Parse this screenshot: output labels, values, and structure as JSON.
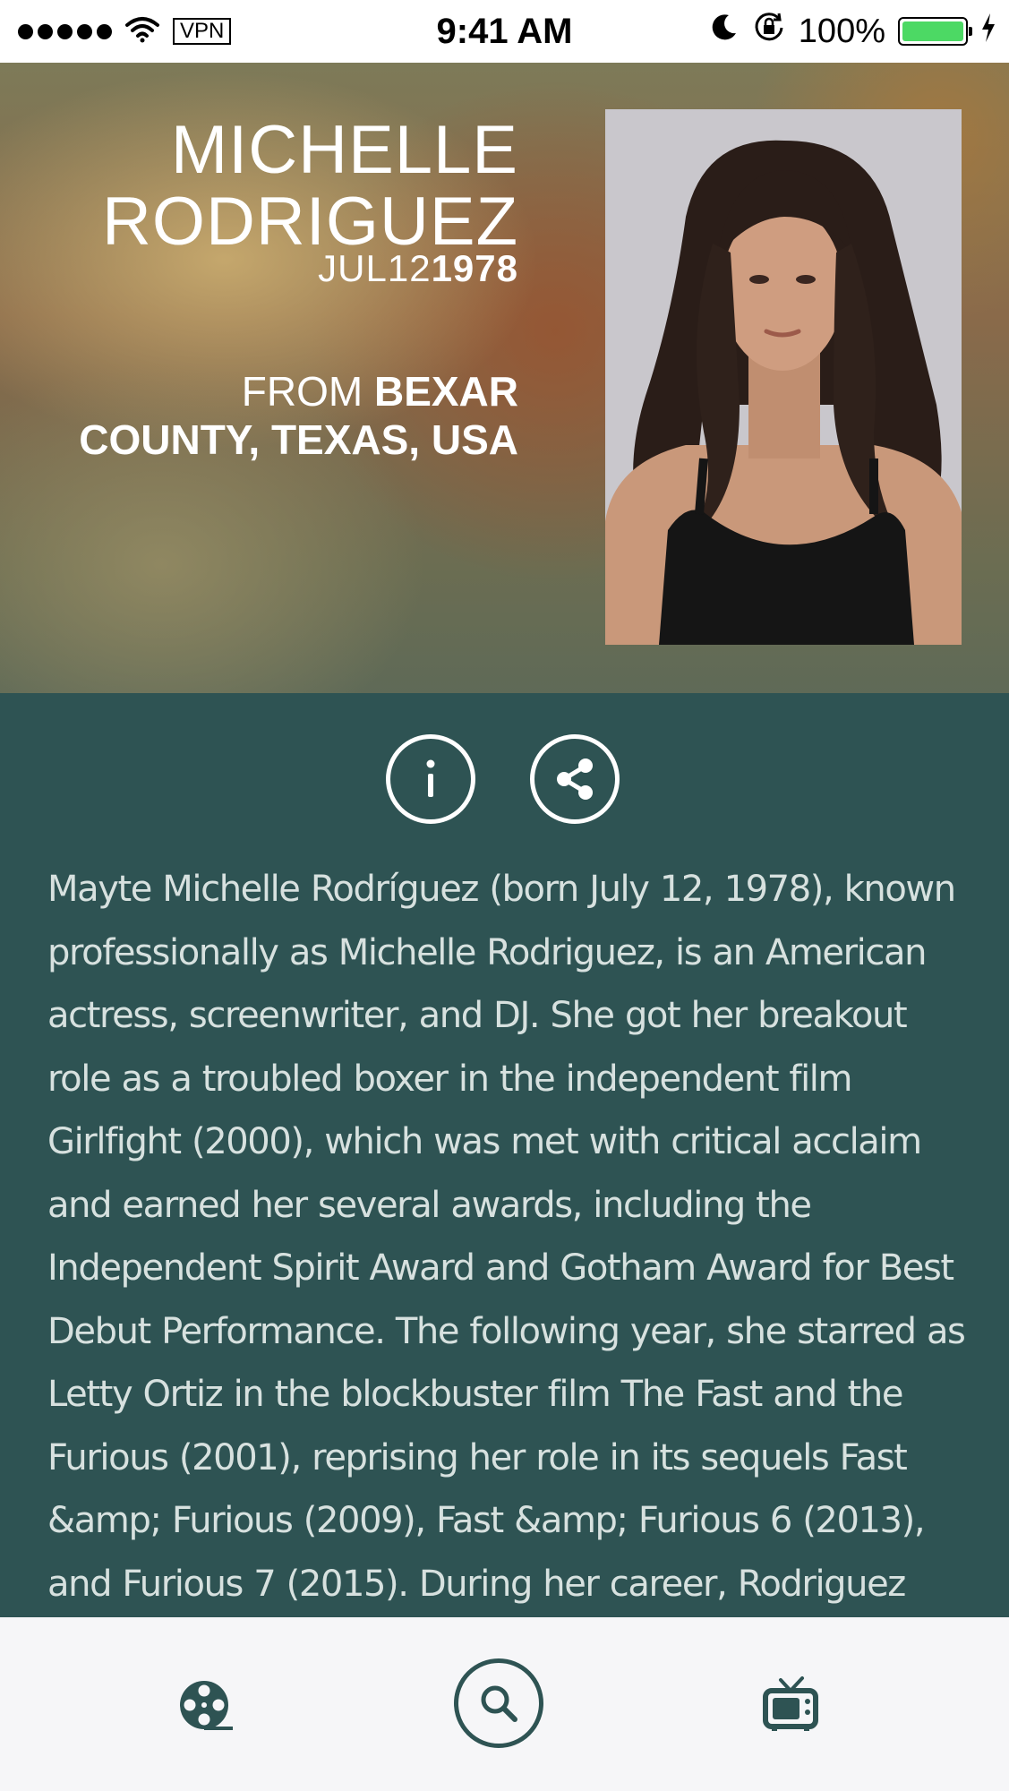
{
  "status_bar": {
    "carrier": "VPN",
    "time": "9:41 AM",
    "battery_percent": "100%",
    "battery_level": 1.0,
    "icons": [
      "signal-dots-icon",
      "wifi-icon",
      "moon-icon",
      "rotation-lock-icon",
      "battery-icon",
      "charging-icon"
    ]
  },
  "person": {
    "name_line1": "MICHELLE",
    "name_line2": "RODRIGUEZ",
    "birth_month": "JUL",
    "birth_day": "12",
    "birth_year": "1978",
    "from_label": "FROM",
    "from_place_line1": "BEXAR",
    "from_place_line2": "COUNTY, TEXAS, USA"
  },
  "actions": {
    "info_label": "i",
    "icons": [
      "info-icon",
      "share-icon"
    ]
  },
  "bio": "Mayte Michelle Rodríguez (born July 12, 1978), known professionally as Michelle Rodriguez, is an American actress, screenwriter, and DJ. She got her breakout role as a troubled boxer in the independent film Girlfight (2000), which was met with critical acclaim and earned her several awards, including the Independent Spirit Award and Gotham Award for Best Debut Performance. The following year, she starred as Letty Ortiz in the blockbuster film The Fast and the Furious (2001), reprising her role in its sequels Fast &amp; Furious (2009), Fast &amp; Furious 6 (2013), and Furious 7 (2015). During her career, Rodriguez has played tough, independent women in a number of successful action films, such as Blue Crush, S.W.A.T., Battle:",
  "tabbar": {
    "icons": [
      "film-reel-icon",
      "search-icon",
      "tv-icon"
    ]
  },
  "colors": {
    "teal": "#2e5353",
    "bio_text": "#d7e1df",
    "tabbar_bg": "#f6f6f8",
    "battery_green": "#4cd964"
  }
}
